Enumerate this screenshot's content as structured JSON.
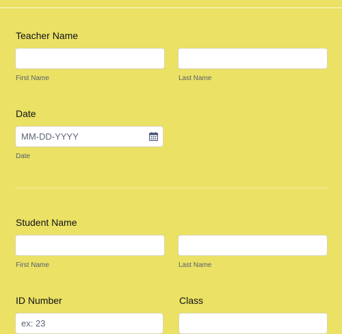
{
  "teacher": {
    "label": "Teacher Name",
    "first_sublabel": "First Name",
    "last_sublabel": "Last Name"
  },
  "date": {
    "label": "Date",
    "placeholder": "MM-DD-YYYY",
    "sublabel": "Date",
    "icon": "calendar-icon"
  },
  "student": {
    "label": "Student Name",
    "first_sublabel": "First Name",
    "last_sublabel": "Last Name"
  },
  "id_number": {
    "label": "ID Number",
    "placeholder": "ex: 23"
  },
  "class_field": {
    "label": "Class"
  },
  "colors": {
    "background": "#ebe164",
    "input_bg": "#ffffff",
    "icon": "#4a5878"
  }
}
